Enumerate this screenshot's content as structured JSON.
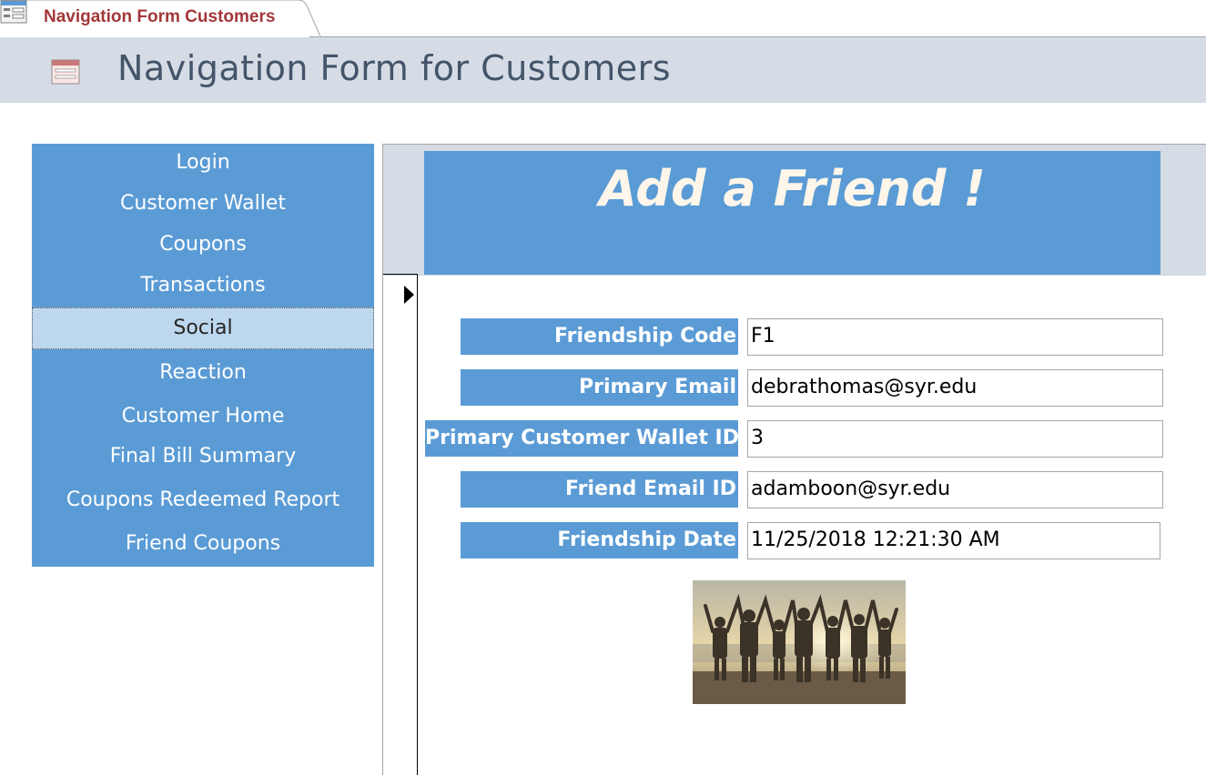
{
  "tab": {
    "label": "Navigation Form Customers",
    "icon": "form-icon"
  },
  "header": {
    "title": "Navigation Form for Customers",
    "icon": "form-icon"
  },
  "nav": {
    "items": [
      {
        "label": "Login"
      },
      {
        "label": "Customer Wallet"
      },
      {
        "label": "Coupons"
      },
      {
        "label": "Transactions"
      },
      {
        "label": "Social"
      },
      {
        "label": "Reaction"
      },
      {
        "label": "Customer Home"
      },
      {
        "label": "Final Bill Summary"
      },
      {
        "label": "Coupons Redeemed Report"
      },
      {
        "label": "Friend Coupons"
      }
    ],
    "selected": "Social"
  },
  "form": {
    "title": "Add a Friend !",
    "fields": [
      {
        "label": "Friendship Code",
        "value": "F1"
      },
      {
        "label": "Primary Email",
        "value": "debrathomas@syr.edu"
      },
      {
        "label": "Primary Customer Wallet ID",
        "value": "3"
      },
      {
        "label": "Friend Email ID",
        "value": "adamboon@syr.edu"
      },
      {
        "label": "Friendship Date",
        "value": "11/25/2018 12:21:30 AM"
      }
    ],
    "image": "friends-silhouette-photo"
  },
  "colors": {
    "accent": "#5b9bd5",
    "header_bg": "#d6dce5",
    "selected_bg": "#bdd7ee",
    "tab_text": "#a4373a",
    "title_text": "#44546a"
  }
}
